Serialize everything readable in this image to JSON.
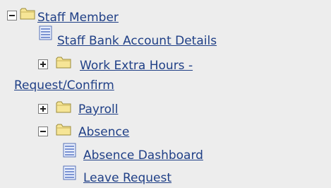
{
  "tree": {
    "staff_member": {
      "label": "Staff Member",
      "state": "expanded"
    },
    "staff_bank_account_details": {
      "label": "Staff Bank Account Details"
    },
    "work_extra_hours": {
      "label_line1": "Work Extra Hours -",
      "label_line2": "Request/Confirm",
      "state": "collapsed"
    },
    "payroll": {
      "label": "Payroll",
      "state": "collapsed"
    },
    "absence": {
      "label": "Absence",
      "state": "expanded"
    },
    "absence_dashboard": {
      "label": "Absence Dashboard"
    },
    "leave_request": {
      "label": "Leave Request"
    }
  },
  "colors": {
    "background": "#ededed",
    "link": "#1f3f86",
    "folder": "#f4e08a",
    "document": "#8aa2da"
  },
  "icons": {
    "expanded": "minus-box-icon",
    "collapsed": "plus-box-icon",
    "folder": "folder-icon",
    "page": "page-icon"
  }
}
